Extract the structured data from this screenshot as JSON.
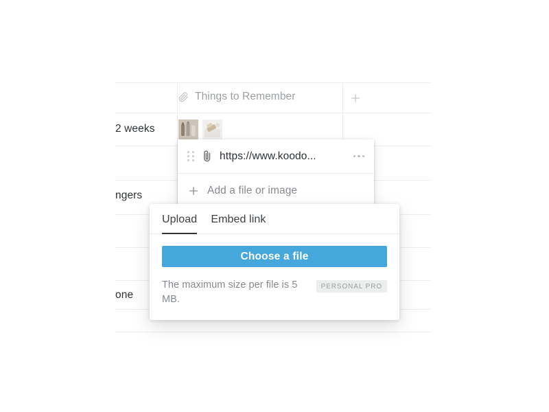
{
  "table": {
    "header": {
      "icon": "paperclip-icon",
      "label": "Things to Remember",
      "add_column_icon": "plus-icon"
    },
    "rows": [
      {
        "label": "2 weeks",
        "thumbnails": [
          "image-thumbnail-bottles",
          "image-thumbnail-soap"
        ]
      },
      {
        "label": ""
      },
      {
        "label": "ngers"
      },
      {
        "label": ""
      },
      {
        "label": ""
      },
      {
        "label": "one"
      },
      {
        "label": ""
      }
    ]
  },
  "attachment_popup": {
    "items": [
      {
        "drag_handle_icon": "drag-handle-icon",
        "file_icon": "paperclip-icon",
        "label": "https://www.koodo...",
        "menu_icon": "more-options-icon"
      }
    ],
    "add_row": {
      "icon": "plus-icon",
      "label": "Add a file or image"
    }
  },
  "upload_dialog": {
    "tabs": [
      {
        "label": "Upload",
        "active": true
      },
      {
        "label": "Embed link",
        "active": false
      }
    ],
    "choose_file_button": "Choose a file",
    "note": "The maximum size per file is 5 MB.",
    "badge": "PERSONAL PRO",
    "accent_color": "#45a7dc",
    "badge_bg": "#eceded",
    "badge_text_color": "#9b9fa2"
  }
}
